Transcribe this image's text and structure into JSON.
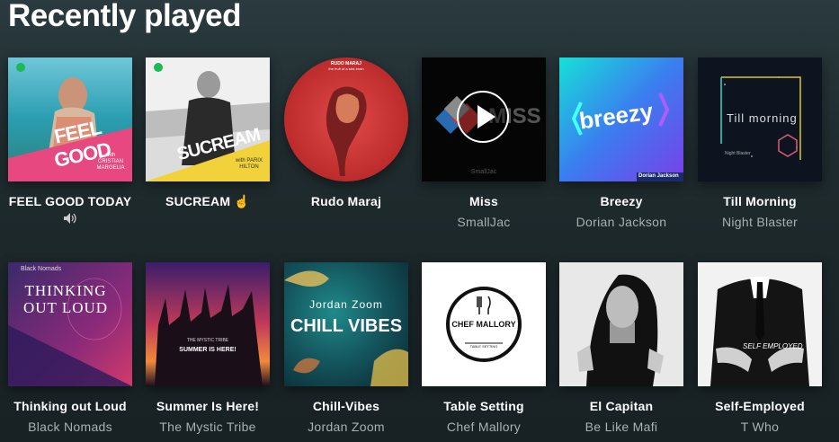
{
  "section_title": "Recently played",
  "items": [
    {
      "name": "FEEL GOOD TODAY",
      "subtitle": "",
      "now_playing": true,
      "art_text": "FEEL GOOD",
      "art_small": "with CRISTIAN MARGELIA"
    },
    {
      "name": "SUCREAM ☝",
      "subtitle": "",
      "art_text": "SUCREAM",
      "art_small": "with PARIX HILTON"
    },
    {
      "name": "Rudo Maraj",
      "subtitle": "",
      "art_text": "RUDO MARAJ",
      "art_small": "the fruit of a sick brain"
    },
    {
      "name": "Miss",
      "subtitle": "SmallJac",
      "art_text": "MISS",
      "art_small": "SmallJac"
    },
    {
      "name": "Breezy",
      "subtitle": "Dorian Jackson",
      "art_text": "breezy",
      "art_small": "Dorian Jackson"
    },
    {
      "name": "Till Morning",
      "subtitle": "Night Blaster",
      "art_text": "Till morning",
      "art_small": "Night Blaster"
    },
    {
      "name": "Thinking out Loud",
      "subtitle": "Black Nomads",
      "art_text": "THINKING OUT LOUD",
      "art_small": "Black Nomads"
    },
    {
      "name": "Summer Is Here!",
      "subtitle": "The Mystic Tribe",
      "art_text": "SUMMER IS HERE!",
      "art_small": "THE MYSTIC TRIBE"
    },
    {
      "name": "Chill-Vibes",
      "subtitle": "Jordan Zoom",
      "art_text": "CHILL VIBES",
      "art_small": "Jordan Zoom"
    },
    {
      "name": "Table Setting",
      "subtitle": "Chef Mallory",
      "art_text": "CHEF MALLORY",
      "art_small": "TABLE SETTING"
    },
    {
      "name": "El Capitan",
      "subtitle": "Be Like Mafi",
      "art_text": "",
      "art_small": ""
    },
    {
      "name": "Self-Employed",
      "subtitle": "T Who",
      "art_text": "SELF EMPLOYED",
      "art_small": ""
    }
  ],
  "icons": {
    "speaker": "speaker-icon",
    "play": "play-icon",
    "spotify": "spotify-icon"
  }
}
